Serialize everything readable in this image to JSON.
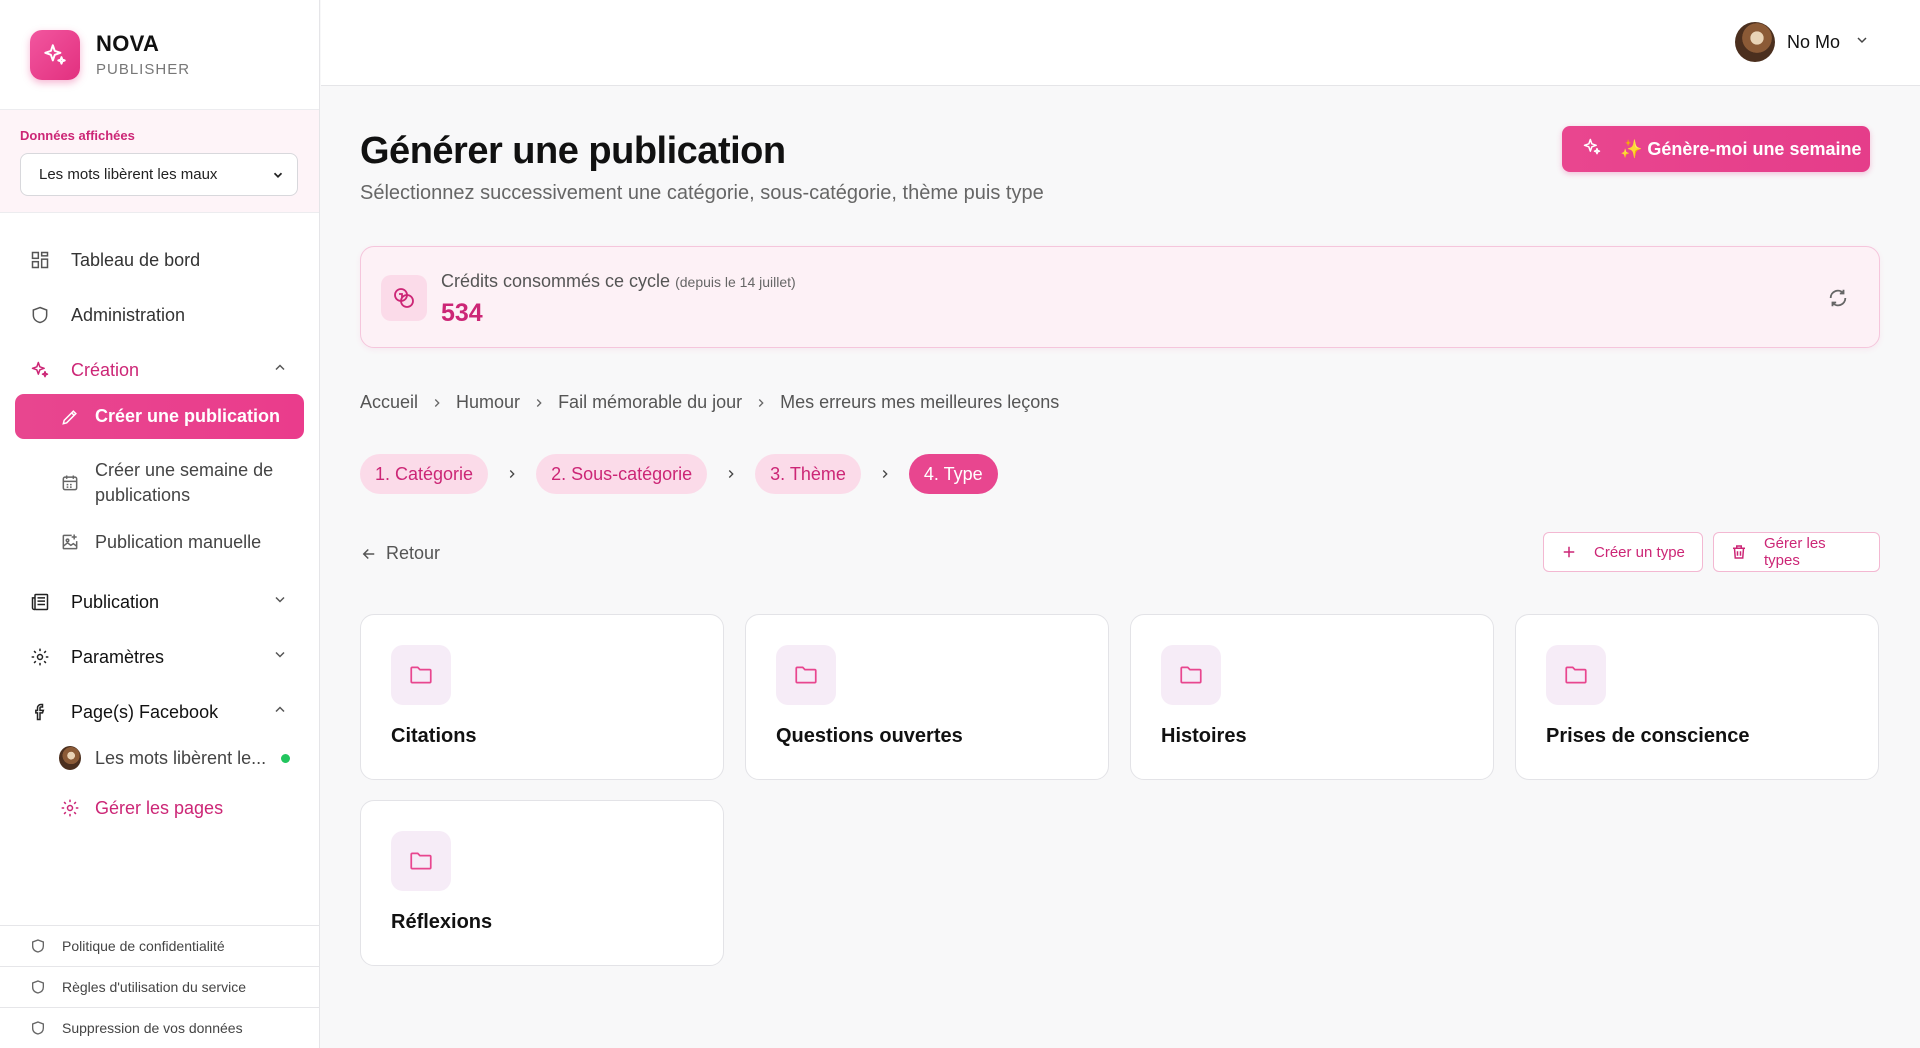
{
  "brand": {
    "name": "NOVA",
    "subtitle": "PUBLISHER"
  },
  "data_selector": {
    "label": "Données affichées",
    "value": "Les mots libèrent les maux"
  },
  "nav": {
    "dashboard": "Tableau de bord",
    "administration": "Administration",
    "creation": "Création",
    "create_publication": "Créer une publication",
    "create_week": "Créer une semaine de publications",
    "manual_publication": "Publication manuelle",
    "publication": "Publication",
    "settings": "Paramètres",
    "facebook_pages": "Page(s) Facebook",
    "facebook_page_name": "Les mots libèrent le...",
    "manage_pages": "Gérer les pages"
  },
  "footer": {
    "privacy": "Politique de confidentialité",
    "terms": "Règles d'utilisation du service",
    "data_deletion": "Suppression de vos données"
  },
  "user": {
    "name": "No Mo"
  },
  "header": {
    "title": "Générer une publication",
    "subtitle": "Sélectionnez successivement une catégorie, sous-catégorie, thème puis type",
    "generate_week_label": "✨ Génère-moi une semaine"
  },
  "credits": {
    "label": "Crédits consommés ce cycle",
    "since": "(depuis le 14 juillet)",
    "value": "534"
  },
  "breadcrumb": [
    "Accueil",
    "Humour",
    "Fail mémorable du jour",
    "Mes erreurs mes meilleures leçons"
  ],
  "steps": [
    "1. Catégorie",
    "2. Sous-catégorie",
    "3. Thème",
    "4. Type"
  ],
  "actions": {
    "back": "Retour",
    "create_type": "Créer un type",
    "manage_types": "Gérer les types"
  },
  "types": [
    "Citations",
    "Questions ouvertes",
    "Histoires",
    "Prises de conscience",
    "Réflexions"
  ],
  "colors": {
    "accent": "#e8468f",
    "accent_dark": "#cc2676",
    "accent_light": "#fbdbe9",
    "online": "#22c55e"
  }
}
